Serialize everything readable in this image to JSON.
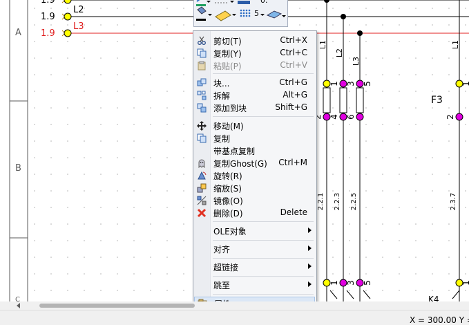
{
  "drawing": {
    "rows": [
      {
        "value": "1.9",
        "label": "",
        "color": "#000000"
      },
      {
        "value": "1.9",
        "label": "L2",
        "color": "#000000"
      },
      {
        "value": "1.9",
        "label": "L3",
        "color": "#e02020"
      }
    ],
    "zones": [
      "A",
      "B",
      "C"
    ],
    "vertical_labels": [
      "L1",
      "L2",
      "L3",
      "L1"
    ],
    "column_refs": [
      "2.2.1",
      "2.2.3",
      "2.2.5",
      "2.3.7"
    ],
    "component_labels": [
      "F3",
      "K4"
    ],
    "pin_numbers": [
      "1",
      "3",
      "5",
      "1",
      "2",
      "4",
      "6",
      "2",
      "1",
      "3",
      "5",
      "1"
    ],
    "colors": {
      "phase_line": "#e02020",
      "pin_dot": "#e000e0",
      "terminal": "#ffff00",
      "grid_dot": "#b0b0b0"
    }
  },
  "toolbar": {
    "line_weight_value": "0.",
    "grid_value": "5"
  },
  "context_menu": {
    "items": [
      {
        "label": "剪切(T)",
        "shortcut": "Ctrl+X",
        "icon": "scissors-icon",
        "enabled": true
      },
      {
        "label": "复制(Y)",
        "shortcut": "Ctrl+C",
        "icon": "copy-icon",
        "enabled": true
      },
      {
        "label": "粘贴(P)",
        "shortcut": "Ctrl+V",
        "icon": "paste-icon",
        "enabled": false
      },
      {
        "label": "块...",
        "shortcut": "Ctrl+G",
        "icon": "block-icon",
        "enabled": true
      },
      {
        "label": "拆解",
        "shortcut": "Alt+G",
        "icon": "explode-icon",
        "enabled": true
      },
      {
        "label": "添加到块",
        "shortcut": "Shift+G",
        "icon": "add-to-block-icon",
        "enabled": true
      },
      {
        "label": "移动(M)",
        "shortcut": "",
        "icon": "move-icon",
        "enabled": true
      },
      {
        "label": "复制",
        "shortcut": "",
        "icon": "copy-icon",
        "enabled": true
      },
      {
        "label": "带基点复制",
        "shortcut": "",
        "icon": "",
        "enabled": true
      },
      {
        "label": "复制Ghost(G)",
        "shortcut": "Ctrl+M",
        "icon": "ghost-copy-icon",
        "enabled": true
      },
      {
        "label": "旋转(R)",
        "shortcut": "",
        "icon": "rotate-icon",
        "enabled": true
      },
      {
        "label": "缩放(S)",
        "shortcut": "",
        "icon": "scale-icon",
        "enabled": true
      },
      {
        "label": "镜像(O)",
        "shortcut": "",
        "icon": "mirror-icon",
        "enabled": true
      },
      {
        "label": "删除(D)",
        "shortcut": "Delete",
        "icon": "delete-icon",
        "enabled": true
      },
      {
        "label": "OLE对象",
        "submenu": true
      },
      {
        "label": "对齐",
        "submenu": true
      },
      {
        "label": "超链接",
        "submenu": true
      },
      {
        "label": "跳至",
        "submenu": true
      },
      {
        "label": "属性...",
        "shortcut": "",
        "icon": "properties-icon",
        "enabled": true,
        "highlighted": true
      }
    ]
  },
  "status": {
    "coords": "X = 300.00  Y ="
  }
}
